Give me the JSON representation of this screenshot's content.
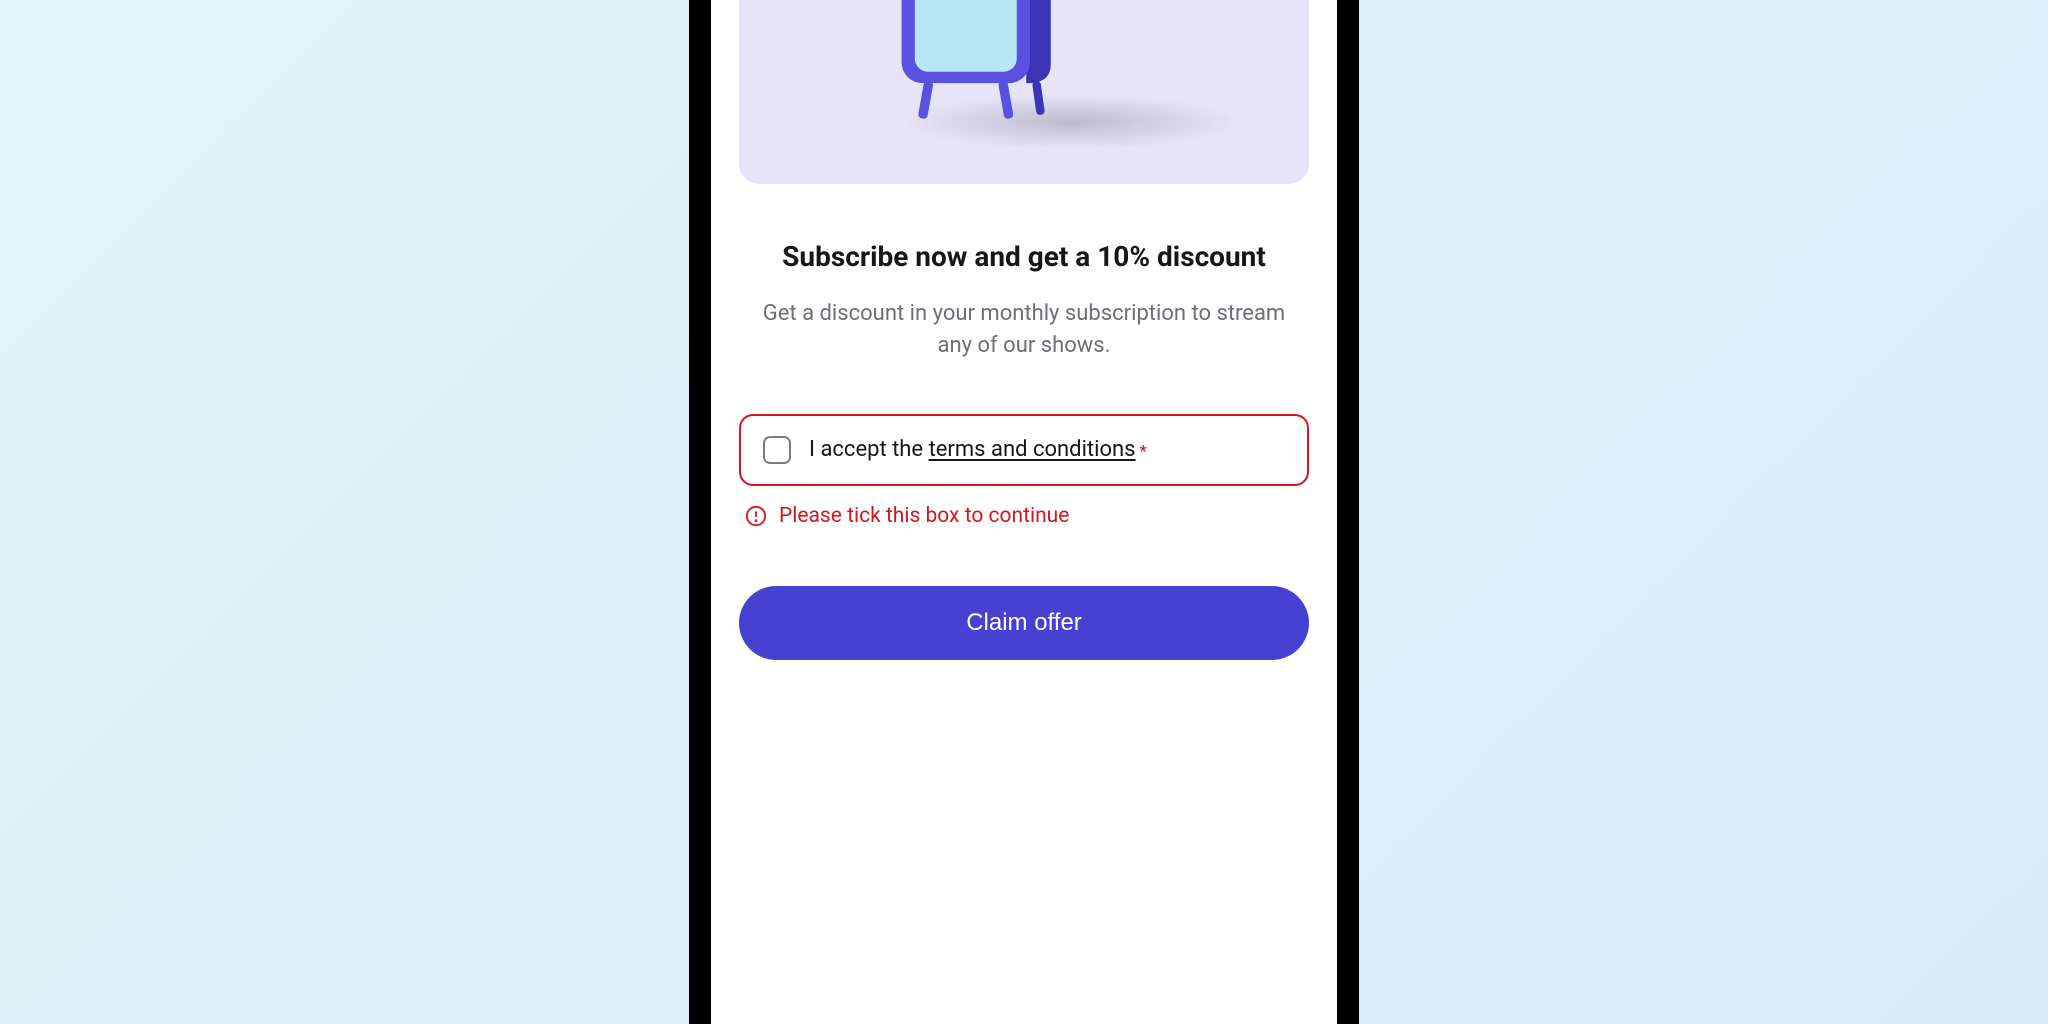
{
  "offer": {
    "headline": "Subscribe now and get a 10% discount",
    "subhead": "Get a discount in your monthly subscription to stream any of our shows."
  },
  "consent": {
    "label_prefix": "I accept the ",
    "link_text": "terms and conditions",
    "required_mark": "*",
    "error_message": "Please tick this box to continue",
    "checked": false
  },
  "cta": {
    "label": "Claim offer"
  },
  "colors": {
    "accent": "#4840d1",
    "error": "#d1181f",
    "hero_bg": "#e7e4f8"
  }
}
